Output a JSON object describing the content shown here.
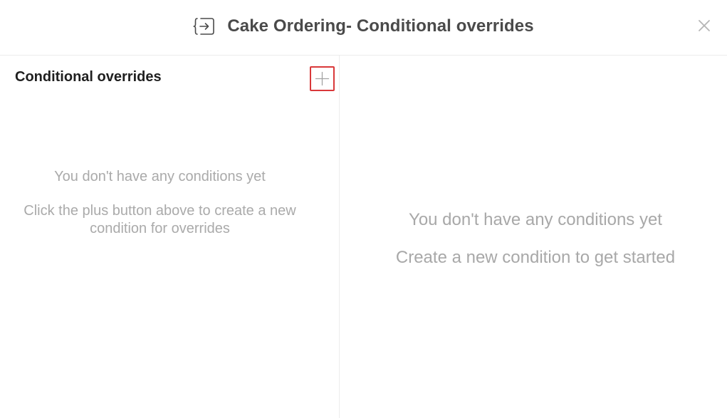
{
  "dialog": {
    "title": "Cake Ordering- Conditional overrides",
    "title_icon": "override-brackets-icon",
    "close_icon": "close-icon"
  },
  "left_panel": {
    "title": "Conditional overrides",
    "add_icon": "plus-icon",
    "empty_title": "You don't have any conditions yet",
    "empty_hint": "Click the plus button above to create a new condition for overrides"
  },
  "right_panel": {
    "empty_title": "You don't have any conditions yet",
    "empty_hint": "Create a new condition to get started"
  },
  "colors": {
    "title_text": "#4a4a4a",
    "muted_text": "#aaaaaa",
    "highlight_border": "#d9383a",
    "divider": "#ececec"
  }
}
